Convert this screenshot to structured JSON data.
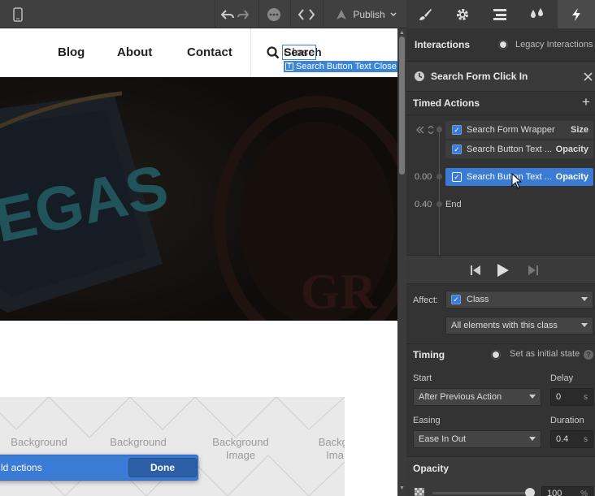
{
  "toolbar": {
    "publish_label": "Publish"
  },
  "canvas": {
    "nav": {
      "links": [
        "Blog",
        "About",
        "Contact"
      ],
      "search_label": "Search",
      "search_overlap_label": "Close"
    },
    "selection_label": "Search Button Text Close",
    "background_labels": [
      "Background",
      "Background",
      "Background\nImage",
      "Backgr\nIma"
    ],
    "toast": {
      "text": "ld actions",
      "button": "Done"
    }
  },
  "panel": {
    "interactions_title": "Interactions",
    "legacy_label": "Legacy Interactions",
    "trigger_title": "Search Form Click In",
    "timed_actions_title": "Timed Actions",
    "actions": [
      {
        "name": "Search Form Wrapper",
        "type": "Size"
      },
      {
        "name": "Search Button Text ...",
        "type": "Opacity"
      },
      {
        "name": "Search Button Text ...",
        "type": "Opacity"
      }
    ],
    "timeline_times": [
      "0.00",
      "0.40"
    ],
    "end_label": "End",
    "affect_label": "Affect:",
    "affect_value": "Class",
    "affect_scope": "All elements with this class",
    "timing_title": "Timing",
    "initial_state_label": "Set as initial state",
    "start_label": "Start",
    "start_value": "After Previous Action",
    "delay_label": "Delay",
    "delay_value": "0",
    "delay_unit": "s",
    "easing_label": "Easing",
    "easing_value": "Ease In Out",
    "duration_label": "Duration",
    "duration_value": "0.4",
    "duration_unit": "s",
    "opacity_title": "Opacity",
    "opacity_value": "100",
    "opacity_unit": "%"
  }
}
